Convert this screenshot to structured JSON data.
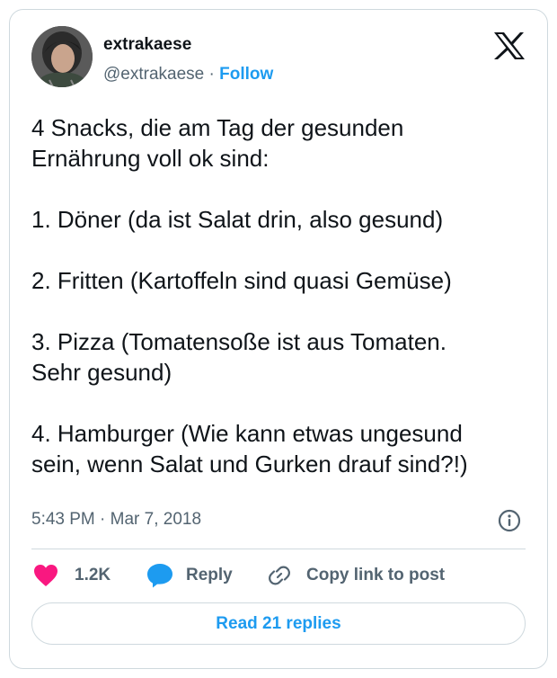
{
  "tweet": {
    "display_name": "extrakaese",
    "handle": "@extrakaese",
    "separator": " · ",
    "follow_label": "Follow",
    "text": "4 Snacks, die am Tag der gesunden\nErnährung voll ok sind:\n\n1. Döner (da ist Salat drin, also gesund)\n\n2. Fritten (Kartoffeln sind quasi Gemüse)\n\n3. Pizza (Tomatensoße ist aus Tomaten.\nSehr gesund)\n\n4. Hamburger (Wie kann etwas ungesund\nsein, wenn Salat und Gurken drauf sind?!)",
    "time": "5:43 PM",
    "date": "Mar 7, 2018"
  },
  "actions": {
    "like_count": "1.2K",
    "reply_label": "Reply",
    "copy_label": "Copy link to post",
    "read_replies_label": "Read 21 replies"
  },
  "icons": {
    "like": "heart-icon",
    "reply": "speech-bubble-icon",
    "copy": "link-icon",
    "info": "info-icon",
    "logo": "x-logo-icon"
  },
  "colors": {
    "accent": "#1d9bf0",
    "like": "#f91880",
    "text": "#0f1419",
    "secondary": "#536471",
    "border": "#cfd9de"
  }
}
